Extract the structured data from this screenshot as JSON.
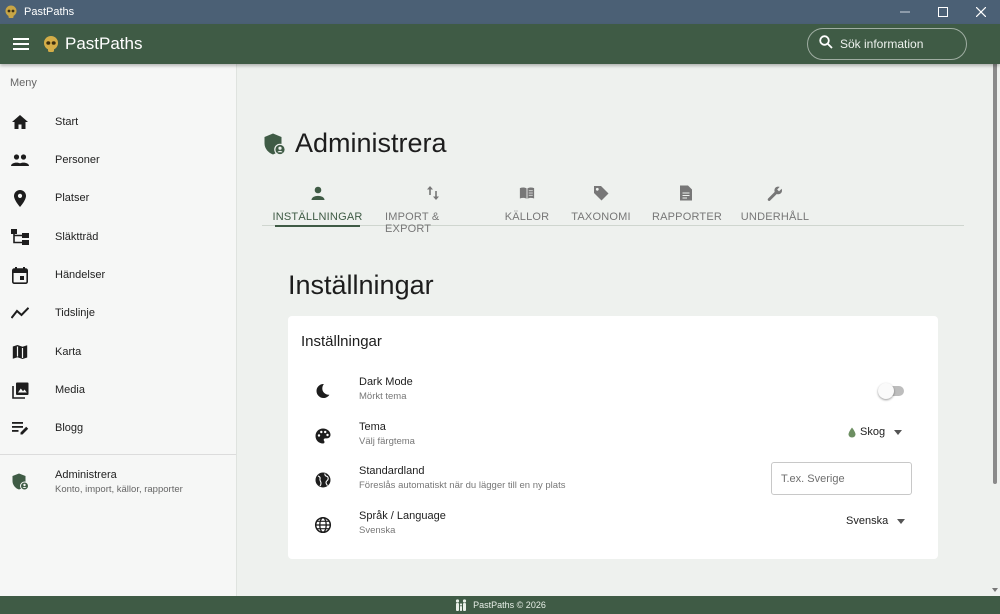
{
  "window": {
    "title": "PastPaths"
  },
  "appbar": {
    "title": "PastPaths",
    "search_placeholder": "Sök information"
  },
  "sidebar": {
    "menu_label": "Meny",
    "items": [
      {
        "label": "Start",
        "icon": "home-icon"
      },
      {
        "label": "Personer",
        "icon": "people-icon"
      },
      {
        "label": "Platser",
        "icon": "location-pin-icon"
      },
      {
        "label": "Släktträd",
        "icon": "family-tree-icon"
      },
      {
        "label": "Händelser",
        "icon": "calendar-event-icon"
      },
      {
        "label": "Tidslinje",
        "icon": "timeline-icon"
      },
      {
        "label": "Karta",
        "icon": "map-icon"
      },
      {
        "label": "Media",
        "icon": "photo-library-icon"
      },
      {
        "label": "Blogg",
        "icon": "edit-note-icon"
      }
    ],
    "admin": {
      "title": "Administrera",
      "subtitle": "Konto, import, källor, rapporter",
      "icon": "admin-shield-icon"
    }
  },
  "main": {
    "page_title": "Administrera",
    "tabs": [
      {
        "label": "INSTÄLLNINGAR",
        "icon": "person-icon",
        "active": true
      },
      {
        "label": "IMPORT & EXPORT",
        "icon": "import-export-icon",
        "active": false
      },
      {
        "label": "KÄLLOR",
        "icon": "book-icon",
        "active": false
      },
      {
        "label": "TAXONOMI",
        "icon": "tag-icon",
        "active": false
      },
      {
        "label": "RAPPORTER",
        "icon": "document-icon",
        "active": false
      },
      {
        "label": "UNDERHÅLL",
        "icon": "wrench-icon",
        "active": false
      }
    ],
    "section_title": "Inställningar",
    "card": {
      "title": "Inställningar",
      "dark_mode": {
        "title": "Dark Mode",
        "subtitle": "Mörkt tema",
        "enabled": false,
        "icon": "moon-icon"
      },
      "theme": {
        "title": "Tema",
        "subtitle": "Välj färgtema",
        "value": "Skog",
        "icon": "palette-icon"
      },
      "country": {
        "title": "Standardland",
        "subtitle": "Föreslås automatiskt när du lägger till en ny plats",
        "placeholder": "T.ex. Sverige",
        "icon": "globe-icon"
      },
      "language": {
        "title": "Språk / Language",
        "subtitle": "Svenska",
        "value": "Svenska",
        "icon": "language-icon"
      }
    }
  },
  "footer": {
    "text": "PastPaths © 2026"
  },
  "colors": {
    "primary": "#3f5b45",
    "titlebar": "#4b6075",
    "background": "#eef1ee"
  }
}
